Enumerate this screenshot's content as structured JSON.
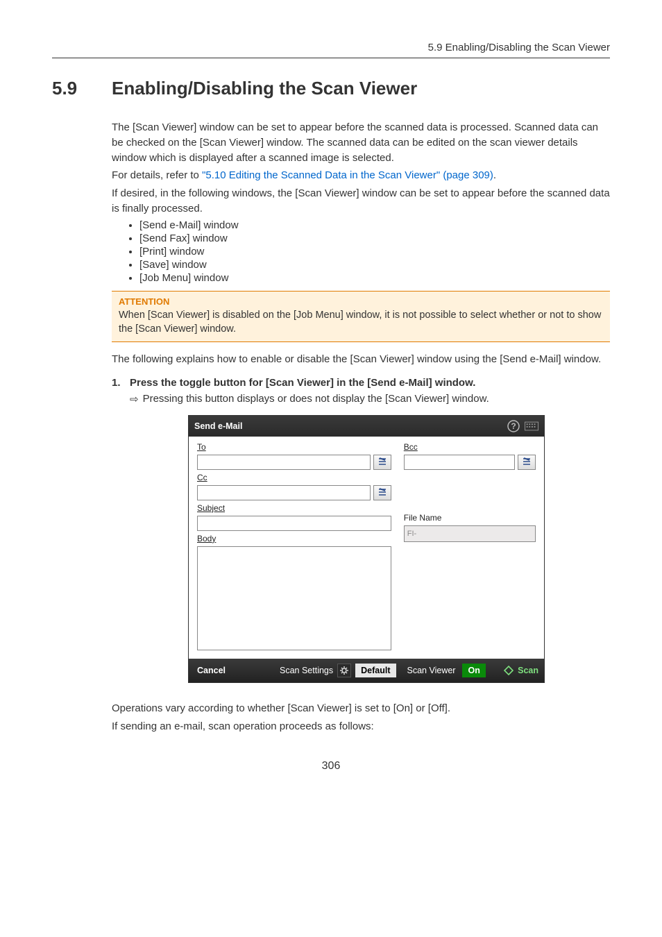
{
  "header": {
    "running": "5.9 Enabling/Disabling the Scan Viewer"
  },
  "title": {
    "num": "5.9",
    "text": "Enabling/Disabling the Scan Viewer"
  },
  "intro": {
    "p1": "The [Scan Viewer] window can be set to appear before the scanned data is processed. Scanned data can be checked on the [Scan Viewer] window. The scanned data can be edited on the scan viewer details window which is displayed after a scanned image is selected.",
    "p2_pre": " For details, refer to ",
    "p2_link": "\"5.10 Editing the Scanned Data in the Scan Viewer\" (page 309)",
    "p2_post": ".",
    "p3": "If desired, in the following windows, the [Scan Viewer] window can be set to appear before the scanned data is finally processed.",
    "bullets": [
      "[Send e-Mail] window",
      "[Send Fax] window",
      "[Print] window",
      "[Save] window",
      "[Job Menu] window"
    ]
  },
  "attention": {
    "title": "ATTENTION",
    "body": "When [Scan Viewer] is disabled on the [Job Menu] window, it is not possible to select whether or not to show the [Scan Viewer] window."
  },
  "lead": "The following explains how to enable or disable the [Scan Viewer] window using the [Send e-Mail] window.",
  "step1": {
    "num": "1.",
    "text": "Press the toggle button for [Scan Viewer] in the [Send e-Mail] window.",
    "result": "Pressing this button displays or does not display the [Scan Viewer] window."
  },
  "tail": {
    "p1": "Operations vary according to whether [Scan Viewer] is set to [On] or [Off].",
    "p2": "If sending an e-mail, scan operation proceeds as follows:"
  },
  "shot": {
    "title": "Send e-Mail",
    "to_label": "To",
    "cc_label": "Cc",
    "bcc_label": "Bcc",
    "subject_label": "Subject",
    "body_label": "Body",
    "filename_label": "File Name",
    "filename_value": "FI-",
    "footer": {
      "cancel": "Cancel",
      "scan_settings": "Scan Settings",
      "default": "Default",
      "scan_viewer": "Scan Viewer",
      "on": "On",
      "scan": "Scan"
    }
  },
  "page_number": "306"
}
